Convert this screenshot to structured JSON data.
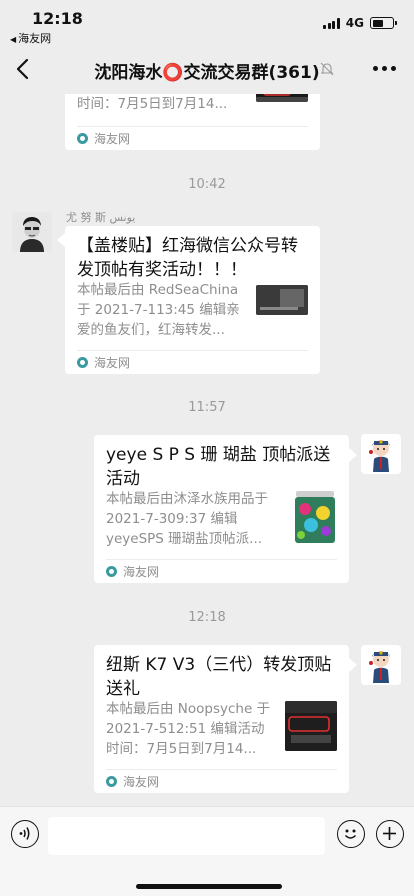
{
  "status_bar": {
    "time": "12:18",
    "back_app": "海友网",
    "network": "4G"
  },
  "nav": {
    "title": "沈阳海水⭕交流交易群(361)"
  },
  "messages": [
    {
      "type": "link-card",
      "partial": true,
      "desc_tail": "时间：7月5日到7月14...",
      "source": "海友网"
    },
    {
      "type": "timestamp",
      "text": "10:42"
    },
    {
      "type": "link-card",
      "sender": "尤 努 斯 يونس",
      "title": "【盖楼贴】红海微信公众号转发顶帖有奖活动！！！",
      "desc": "本帖最后由 RedSeaChina 于 2021-7-113:45 编辑亲爱的鱼友们，红海转发...",
      "source": "海友网"
    },
    {
      "type": "timestamp",
      "text": "11:57"
    },
    {
      "type": "link-card",
      "title": "yeye S P S 珊 瑚盐 顶帖派送活动",
      "desc": "本帖最后由沐泽水族用品于 2021-7-309:37 编辑 yeyeSPS 珊瑚盐顶帖派...",
      "source": "海友网"
    },
    {
      "type": "timestamp",
      "text": "12:18"
    },
    {
      "type": "link-card",
      "title": "纽斯 K7 V3（三代）转发顶贴送礼",
      "desc": "本帖最后由 Noopsyche 于 2021-7-512:51 编辑活动时间：7月5日到7月14...",
      "source": "海友网"
    }
  ],
  "colors": {
    "background": "#ededed",
    "card": "#ffffff",
    "muted_text": "#8e8e8e",
    "source_icon": "#3b9aa0"
  }
}
